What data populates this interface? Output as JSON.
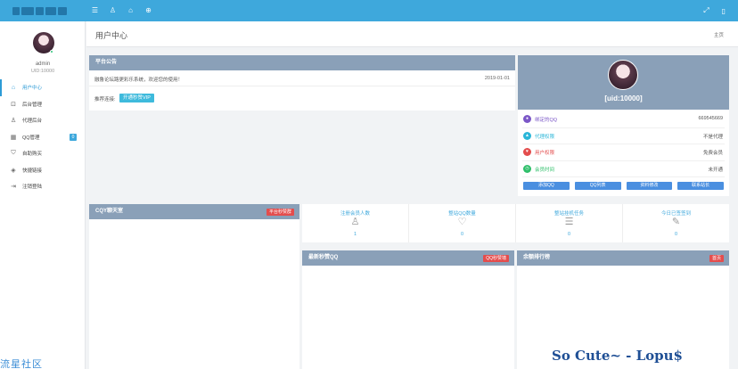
{
  "topbar": {
    "icons": [
      "menu-icon",
      "user-icon",
      "lock-icon",
      "plus-circle-icon"
    ],
    "right_icons": [
      "fullscreen-icon",
      "window-icon"
    ]
  },
  "sidebar": {
    "username": "admin",
    "uid": "UID:10000",
    "items": [
      {
        "label": "用户中心",
        "icon": "home-icon"
      },
      {
        "label": "后台管理",
        "icon": "lock-icon"
      },
      {
        "label": "代理后台",
        "icon": "user-icon"
      },
      {
        "label": "QQ管理",
        "icon": "grid-icon",
        "badge": "0"
      },
      {
        "label": "自助购买",
        "icon": "bag-icon"
      },
      {
        "label": "快捷链接",
        "icon": "layers-icon"
      },
      {
        "label": "注销登陆",
        "icon": "logout-icon"
      }
    ],
    "watermark": "流星社区"
  },
  "header": {
    "title": "用户中心",
    "breadcrumb": "主页"
  },
  "notice": {
    "title": "平台公告",
    "text": "融鲁论坛路更彩乐系统，欢迎您的使用！",
    "date": "2019-01-01",
    "recommend_label": "推荐连接:",
    "recommend_button": "开通秒赞VIP"
  },
  "profile": {
    "uid_label": "[uid:10000]",
    "rows": [
      {
        "label": "绑定的QQ",
        "value": "669545669",
        "color": "#7b57c7"
      },
      {
        "label": "代理权限",
        "value": "不是代理",
        "color": "#2ab6d8"
      },
      {
        "label": "用户权限",
        "value": "免费会员",
        "color": "#e34d4d"
      },
      {
        "label": "会员时间",
        "value": "未开通",
        "color": "#2fbf6a"
      }
    ],
    "buttons": [
      "添加QQ",
      "QQ列表",
      "资料修改",
      "联系站长"
    ]
  },
  "chat": {
    "title": "CQY聊天室",
    "badge": "平台秒赞群"
  },
  "stats": [
    {
      "label": "注册会员人数",
      "icon": "user-outline-icon",
      "value": "1"
    },
    {
      "label": "整站QQ数量",
      "icon": "heart-outline-icon",
      "value": "0"
    },
    {
      "label": "整站挂机任务",
      "icon": "list-icon",
      "value": "0"
    },
    {
      "label": "今日已签签到",
      "icon": "edit-icon",
      "value": "0"
    }
  ],
  "latest": {
    "title": "最新秒赞QQ",
    "badge": "QQ秒赞墙"
  },
  "ranking": {
    "title": "余额排行榜",
    "badge": "首页"
  },
  "watermark_right": "So Cute~ - Lopu$"
}
